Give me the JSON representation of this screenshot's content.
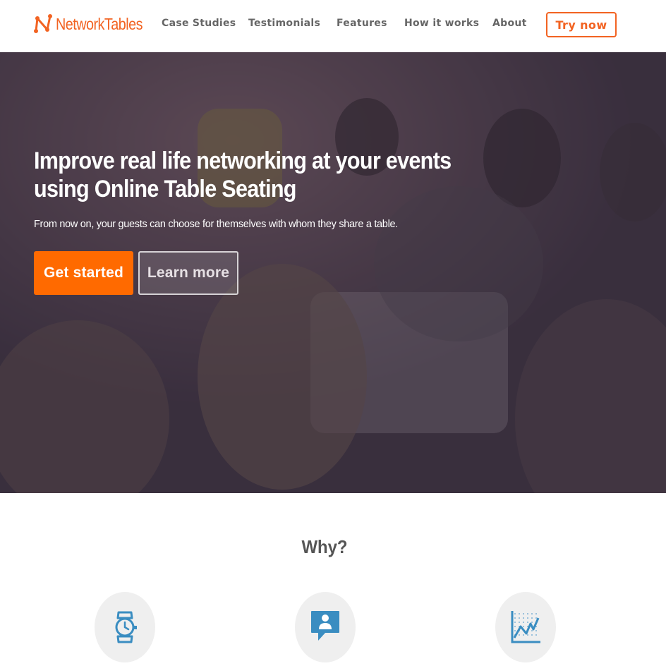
{
  "brand": {
    "name": "NetworkTables",
    "accent": "#f26322",
    "cta_color": "#ff6a00",
    "icon_blue": "#3a8dc1"
  },
  "nav": {
    "items": [
      {
        "label": "Case Studies"
      },
      {
        "label": "Testimonials"
      },
      {
        "label": "Features"
      },
      {
        "label": "How it works"
      },
      {
        "label": "About"
      }
    ],
    "cta_label": "Try now"
  },
  "hero": {
    "title": "Improve real life networking at your events using Online Table Seating",
    "subtitle": "From now on, your guests can choose for themselves with whom they share a table.",
    "primary_button": "Get started",
    "secondary_button": "Learn more"
  },
  "why": {
    "title": "Why?",
    "features": [
      {
        "icon": "wristwatch-icon"
      },
      {
        "icon": "user-speech-bubble-icon"
      },
      {
        "icon": "line-chart-icon"
      }
    ]
  }
}
